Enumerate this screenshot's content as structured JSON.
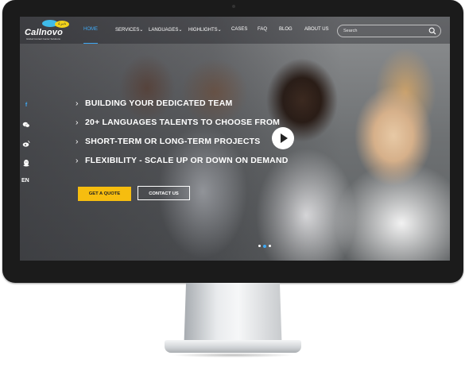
{
  "logo": {
    "word": "Callnovo",
    "bubble_text": "ﺔﺑﺮﻋ",
    "tagline": "Global Contact Center Solutions"
  },
  "nav": {
    "items": [
      {
        "label": "HOME",
        "active": true
      },
      {
        "label": "SERVICES",
        "dropdown": true
      },
      {
        "label": "LANGUAGES",
        "dropdown": true
      },
      {
        "label": "HIGHLIGHTS",
        "dropdown": true
      },
      {
        "label": "CASES"
      },
      {
        "label": "FAQ"
      },
      {
        "label": "BLOG"
      },
      {
        "label": "ABOUT US"
      }
    ]
  },
  "search": {
    "placeholder": "Search"
  },
  "social": [
    "facebook-icon",
    "wechat-icon",
    "weibo-icon",
    "qq-icon"
  ],
  "language_switch": "EN",
  "hero": {
    "bullets": [
      "BUILDING YOUR DEDICATED TEAM",
      "20+ LANGUAGES TALENTS TO CHOOSE FROM",
      "SHORT-TERM OR LONG-TERM PROJECTS",
      "FLEXIBILITY - SCALE UP OR DOWN ON DEMAND"
    ],
    "quote_button": "GET A QUOTE",
    "contact_button": "CONTACT US"
  },
  "slider": {
    "count": 3,
    "active_index": 1
  },
  "colors": {
    "accent": "#3fa9f5",
    "cta": "#f6bd0f",
    "bezel": "#1b1b1b"
  }
}
